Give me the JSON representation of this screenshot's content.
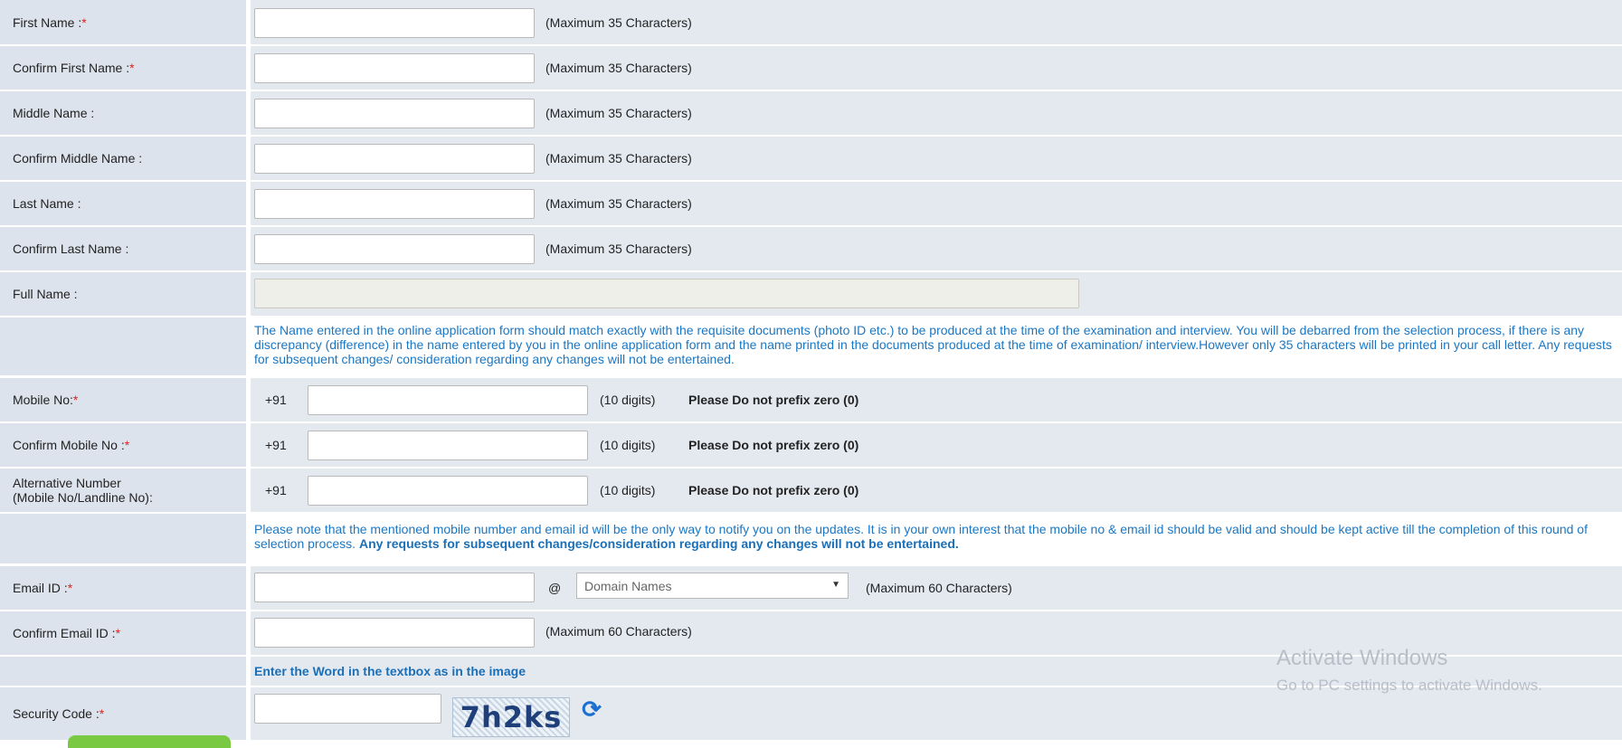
{
  "form": {
    "first_name": {
      "label": "First Name : ",
      "required": "*",
      "hint": "(Maximum 35 Characters)"
    },
    "confirm_first_name": {
      "label": "Confirm First Name : ",
      "required": "*",
      "hint": "(Maximum 35 Characters)"
    },
    "middle_name": {
      "label": "Middle Name :",
      "hint": "(Maximum 35 Characters)"
    },
    "confirm_middle_name": {
      "label": "Confirm Middle Name :",
      "hint": "(Maximum 35 Characters)"
    },
    "last_name": {
      "label": "Last Name :",
      "hint": "(Maximum 35 Characters)"
    },
    "confirm_last_name": {
      "label": "Confirm Last Name :",
      "hint": "(Maximum 35 Characters)"
    },
    "full_name": {
      "label": "Full Name :"
    },
    "name_notice": "The Name entered in the online application form should match exactly with the requisite documents (photo ID etc.) to be produced at the time of the examination and interview. You will be debarred from the selection process, if there is any discrepancy (difference) in the name entered by you in the online application form and the name printed in the documents produced at the time of examination/ interview.However only 35 characters will be printed in your call letter. Any requests for subsequent changes/ consideration regarding any changes will not be entertained.",
    "mobile": {
      "label": "Mobile No:",
      "required": "*",
      "prefix": "+91",
      "hint": "(10 digits)",
      "warning": "Please Do not prefix zero (0)"
    },
    "confirm_mobile": {
      "label": "Confirm Mobile No :",
      "required": "*",
      "prefix": "+91",
      "hint": "(10 digits)",
      "warning": "Please Do not prefix zero (0)"
    },
    "alt_number": {
      "label_line1": "Alternative Number",
      "label_line2": "(Mobile No/Landline No):",
      "prefix": "+91",
      "hint": "(10 digits)",
      "warning": "Please Do not prefix zero (0)"
    },
    "contact_notice": "Please note that the mentioned mobile number and email id will be the only way to notify you on the updates. It is in your own interest that the mobile no & email id should be valid and should be kept active till the completion of this round of selection process. ",
    "contact_notice_bold": "Any requests for subsequent changes/consideration regarding any changes will not be entertained.",
    "email": {
      "label": "Email ID :",
      "required": "*",
      "at": "@",
      "domain_placeholder": "Domain Names",
      "hint": "(Maximum 60 Characters)"
    },
    "confirm_email": {
      "label": "Confirm Email ID : ",
      "required": "*",
      "hint": "(Maximum 60 Characters)"
    },
    "captcha_instruction": "Enter the Word in the textbox as in the image",
    "security_code": {
      "label": "Security Code :",
      "required": "*",
      "captcha_text": "7h2ks"
    }
  },
  "watermark": {
    "title": "Activate Windows",
    "subtitle": "Go to PC settings to activate Windows."
  },
  "colors": {
    "row_bg": "#e4e9f0",
    "label_bg": "#dde3ec",
    "notice_text": "#1a77c4",
    "required": "#d9251d"
  }
}
